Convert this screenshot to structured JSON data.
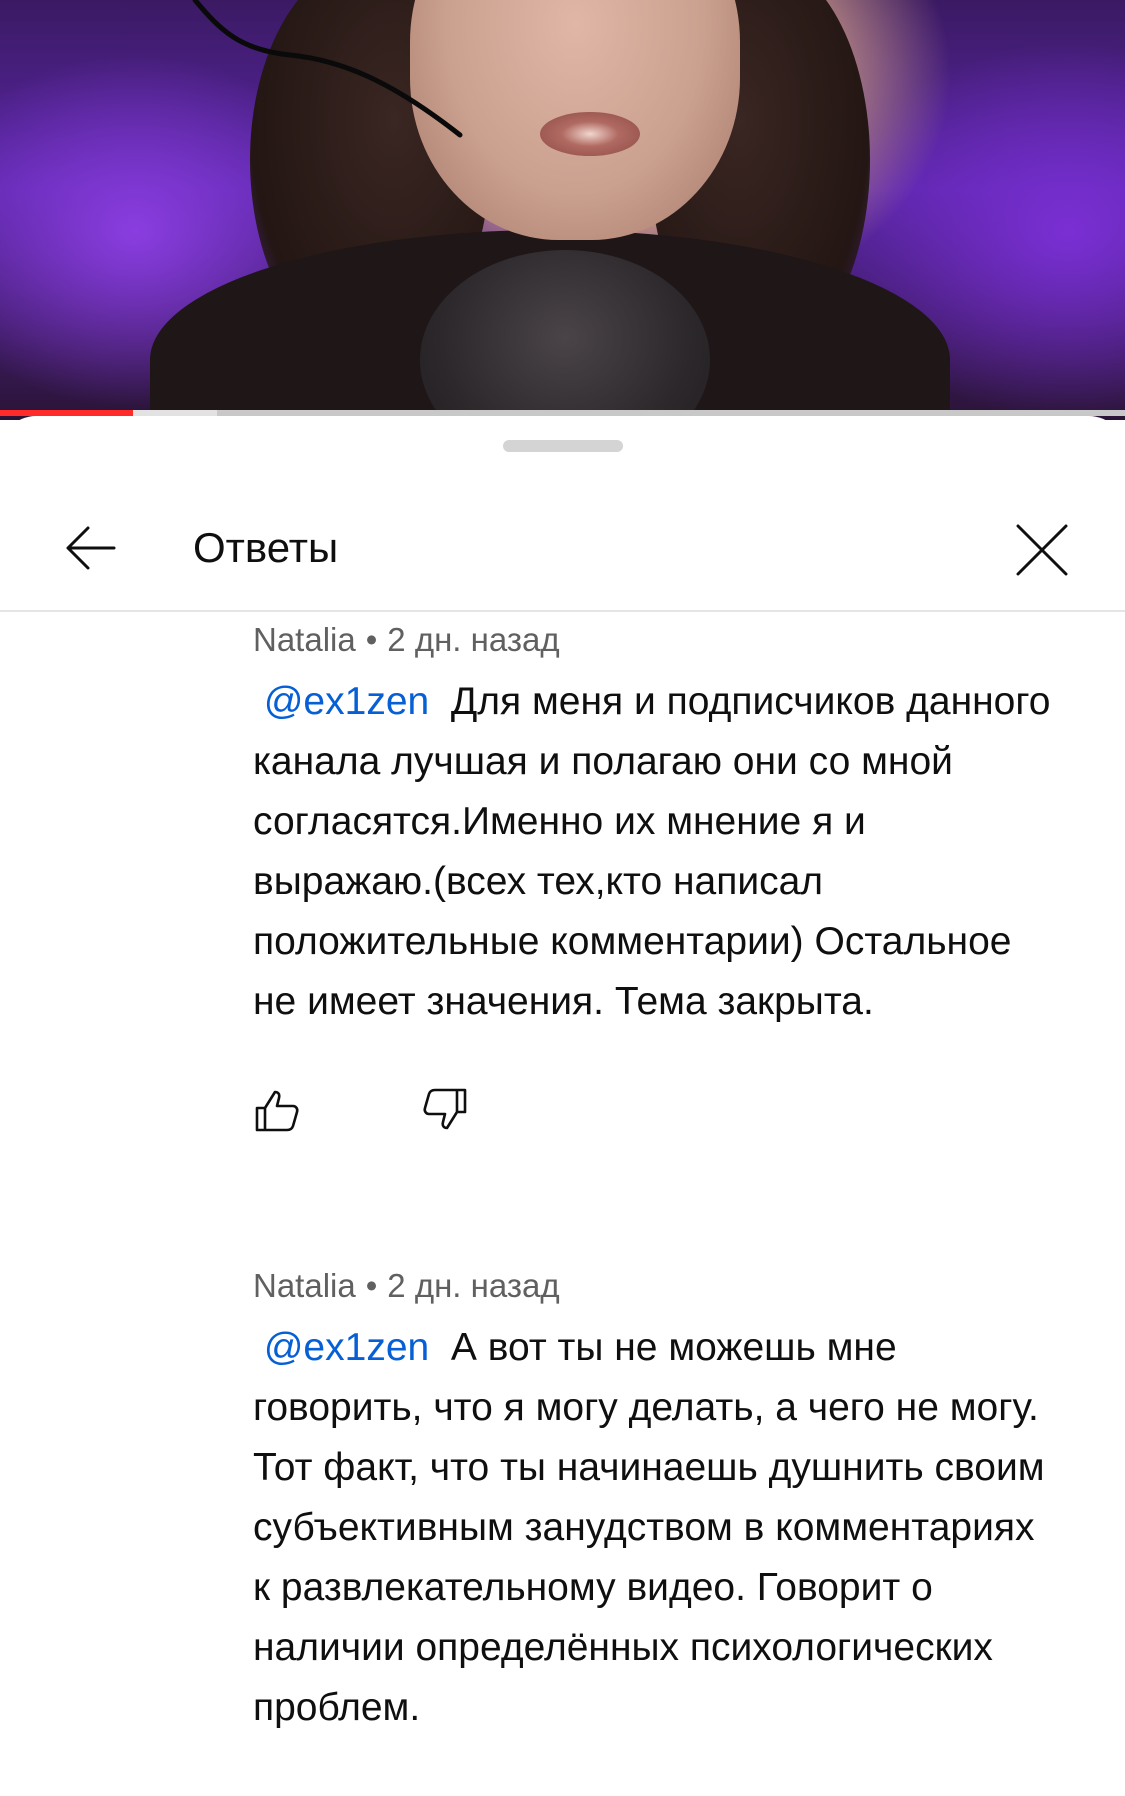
{
  "video": {
    "progress_played": 0.118,
    "progress_buffered": 0.193,
    "colors": {
      "played": "#ff2a2a",
      "buffered": "#e2e2e2",
      "track": "#c8c8c8"
    }
  },
  "header": {
    "title": "Ответы",
    "back_icon": "arrow-left-icon",
    "close_icon": "close-icon"
  },
  "comments": [
    {
      "author": "Natalia",
      "separator": "•",
      "time": "2 дн. назад",
      "mention": "@ex1zen",
      "text": "Для меня и подписчиков данного канала лучшая и полагаю они со мной согласятся.Именно их мнение я и выражаю.(всех тех,кто написал положительные комментарии) Остальное не имеет значения. Тема закрыта.",
      "like_icon": "thumbs-up-icon",
      "dislike_icon": "thumbs-down-icon"
    },
    {
      "author": "Natalia",
      "separator": "•",
      "time": "2 дн. назад",
      "mention": "@ex1zen",
      "text": "А вот ты не можешь мне говорить, что я могу делать, а чего не могу. Тот факт, что ты начинаешь душнить своим субъективным занудством в комментариях к развлекательному видео. Говорит о наличии определённых психологических проблем."
    }
  ]
}
